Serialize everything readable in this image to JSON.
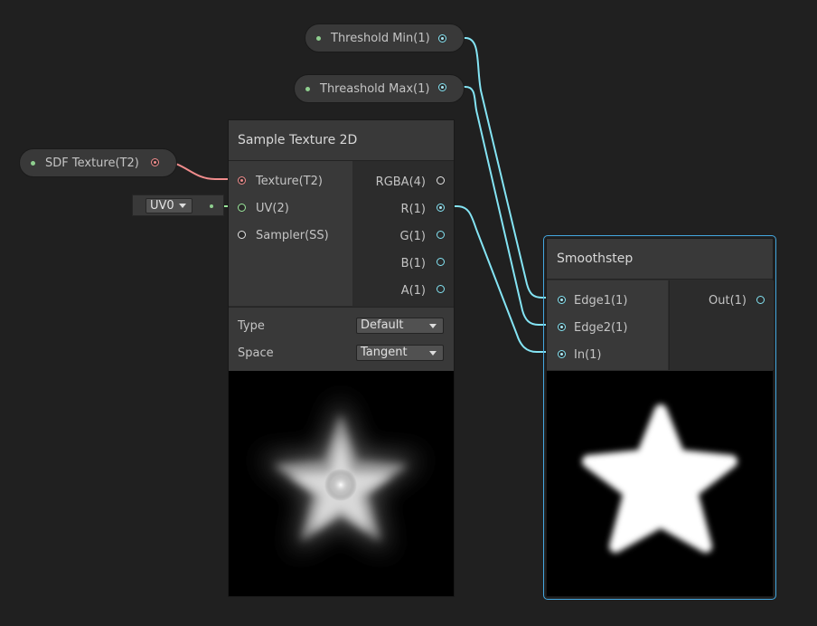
{
  "properties": {
    "threshold_min": "Threshold Min(1)",
    "threshold_max": "Threashold Max(1)",
    "sdf_texture": "SDF Texture(T2)"
  },
  "uv_selector": {
    "value": "UV0"
  },
  "sample_texture": {
    "title": "Sample Texture 2D",
    "inputs": [
      "Texture(T2)",
      "UV(2)",
      "Sampler(SS)"
    ],
    "outputs": [
      "RGBA(4)",
      "R(1)",
      "G(1)",
      "B(1)",
      "A(1)"
    ],
    "type_label": "Type",
    "type_value": "Default",
    "space_label": "Space",
    "space_value": "Tangent"
  },
  "smoothstep": {
    "title": "Smoothstep",
    "inputs": [
      "Edge1(1)",
      "Edge2(1)",
      "In(1)"
    ],
    "outputs": [
      "Out(1)"
    ]
  },
  "colors": {
    "float_wire": "#84e4f4",
    "texture_wire": "#f08c8c",
    "vector2_wire": "#9be89b",
    "selection": "#44a8e0"
  }
}
